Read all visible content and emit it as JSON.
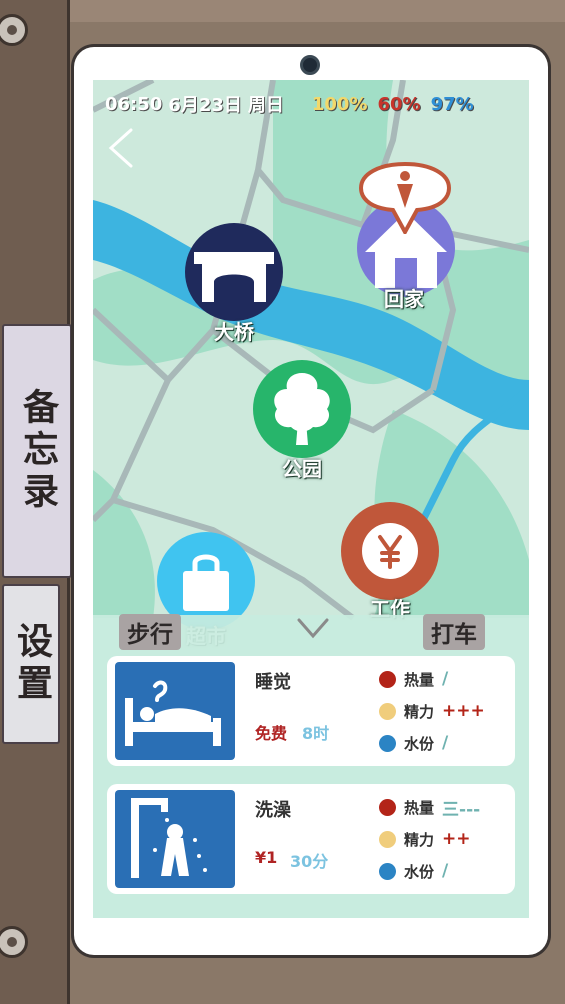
{
  "status_bar": {
    "time": "06:50",
    "date": "6月23日",
    "weekday": "周日",
    "stats": [
      "100%",
      "60%",
      "97%"
    ]
  },
  "navigation": {
    "back_icon": "chevron-left-icon"
  },
  "map": {
    "places": [
      {
        "label": "大桥",
        "icon": "bridge-icon",
        "color": "#1f2a5c"
      },
      {
        "label": "回家",
        "icon": "home-icon",
        "color": "#7b78d8"
      },
      {
        "label": "公园",
        "icon": "tree-icon",
        "color": "#27b56b"
      },
      {
        "label": "超市",
        "icon": "shopping-bag-icon",
        "color": "#40c4f0"
      },
      {
        "label": "工作",
        "icon": "yen-coin-icon",
        "color": "#c0573a"
      }
    ],
    "current_location_marker": "location-pin-icon"
  },
  "transport": {
    "walk_label": "步行",
    "taxi_label": "打车",
    "collapse_icon": "chevron-down-icon"
  },
  "actions": [
    {
      "name": "睡觉",
      "icon": "bed-icon",
      "cost": "免费",
      "duration": "8时",
      "effects": [
        {
          "label": "热量",
          "value": "/"
        },
        {
          "label": "精力",
          "value": "+++"
        },
        {
          "label": "水份",
          "value": "/"
        }
      ]
    },
    {
      "name": "洗澡",
      "icon": "shower-icon",
      "cost": "¥1",
      "duration": "30分",
      "effects": [
        {
          "label": "热量",
          "value": "三---"
        },
        {
          "label": "精力",
          "value": "++"
        },
        {
          "label": "水份",
          "value": "/"
        }
      ]
    }
  ],
  "side_tabs": {
    "memo": "备忘录",
    "settings": "设置"
  }
}
